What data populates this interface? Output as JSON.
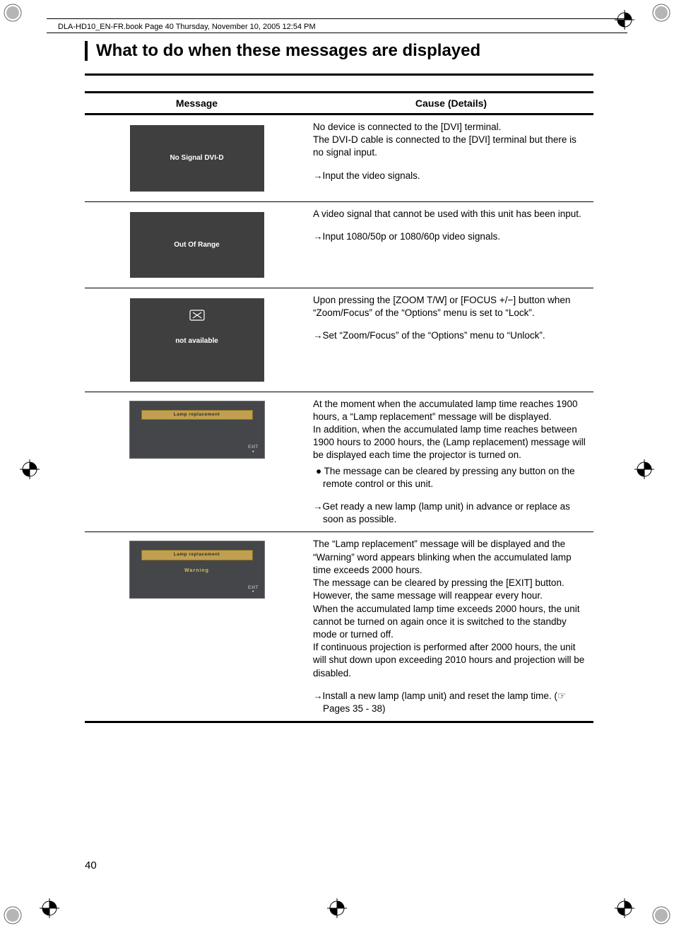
{
  "header": "DLA-HD10_EN-FR.book  Page 40  Thursday, November 10, 2005  12:54 PM",
  "title": "What to do when these messages are displayed",
  "col1": "Message",
  "col2": "Cause (Details)",
  "page_number": "40",
  "rows": [
    {
      "msg_type": "osd",
      "msg_text": "No Signal DVI-D",
      "cause": "No device is connected to the [DVI] terminal.\nThe DVI-D cable is connected to the [DVI] terminal but there is no signal input.",
      "action": "Input the video signals."
    },
    {
      "msg_type": "osd",
      "msg_text": "Out Of Range",
      "cause": "A video signal that cannot be used with this unit has been input.",
      "action": "Input 1080/50p or 1080/60p video signals."
    },
    {
      "msg_type": "osd2",
      "msg_text": "not available",
      "icon": true,
      "cause": "Upon pressing the [ZOOM T/W] or [FOCUS +/−] button when “Zoom/Focus” of the “Options” menu is set to “Lock”.",
      "action": "Set “Zoom/Focus” of the “Options” menu to “Unlock”."
    },
    {
      "msg_type": "osd3",
      "banner": "Lamp replacement",
      "exit": "EXIT",
      "cause": "At the moment when the accumulated lamp time reaches 1900 hours, a “Lamp replacement” message will be displayed.\nIn addition, when the accumulated lamp time reaches between 1900 hours to 2000 hours, the (Lamp replacement) message will be displayed each time the projector is turned on.",
      "bullet": "The message can be cleared by pressing any button on the remote control or this unit.",
      "action": "Get ready a new lamp (lamp unit) in advance or replace as soon as possible."
    },
    {
      "msg_type": "osd3",
      "banner": "Lamp replacement",
      "warning": "Warning",
      "exit": "EXIT",
      "cause": "The “Lamp replacement” message will be displayed and the “Warning” word appears blinking when the accumulated lamp time exceeds 2000 hours.\nThe message can be cleared by pressing the [EXIT] button. However, the same message will reappear every hour.\nWhen the accumulated lamp time exceeds 2000 hours, the unit cannot be turned on again once it is switched to the standby mode or turned off.\nIf continuous projection is performed after 2000 hours, the unit will shut down upon exceeding 2010 hours and projection will be disabled.",
      "action": "Install a new lamp (lamp unit) and reset the lamp time. (☞ Pages 35 - 38)"
    }
  ]
}
